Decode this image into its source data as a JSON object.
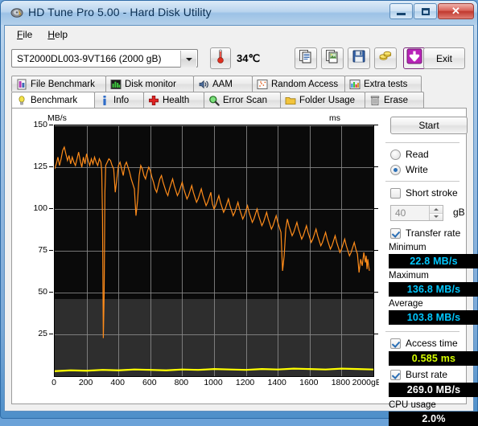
{
  "window": {
    "title": "HD Tune Pro 5.00 - Hard Disk Utility",
    "icon": "hard-disk-icon",
    "minimize_label": "",
    "maximize_label": "",
    "close_label": "✕"
  },
  "menu": {
    "items": [
      {
        "label": "File",
        "accel": "F"
      },
      {
        "label": "Help",
        "accel": "H"
      }
    ]
  },
  "toolbar": {
    "drive": "ST2000DL003-9VT166 (2000 gB)",
    "temperature": "34℃",
    "temperature_icon": "thermometer-icon",
    "buttons": [
      {
        "name": "copy-text-button",
        "icon": "copy-text-icon"
      },
      {
        "name": "copy-image-button",
        "icon": "copy-image-icon"
      },
      {
        "name": "save-button",
        "icon": "floppy-disk-icon"
      },
      {
        "name": "buy-button",
        "icon": "coins-icon"
      },
      {
        "name": "download-button",
        "icon": "download-arrow-icon"
      }
    ],
    "exit_label": "Exit"
  },
  "tabs": {
    "row1": [
      {
        "label": "File Benchmark",
        "icon": "file-benchmark-icon",
        "active": false
      },
      {
        "label": "Disk monitor",
        "icon": "bar-chart-icon",
        "active": false
      },
      {
        "label": "AAM",
        "icon": "speaker-icon",
        "active": false
      },
      {
        "label": "Random Access",
        "icon": "scatter-icon",
        "active": false
      },
      {
        "label": "Extra tests",
        "icon": "extra-chart-icon",
        "active": false
      }
    ],
    "row2": [
      {
        "label": "Benchmark",
        "icon": "lightbulb-icon",
        "active": true
      },
      {
        "label": "Info",
        "icon": "info-icon",
        "active": false
      },
      {
        "label": "Health",
        "icon": "red-cross-icon",
        "active": false
      },
      {
        "label": "Error Scan",
        "icon": "magnifier-icon",
        "active": false
      },
      {
        "label": "Folder Usage",
        "icon": "folder-icon",
        "active": false
      },
      {
        "label": "Erase",
        "icon": "trash-icon",
        "active": false
      }
    ]
  },
  "sidebar": {
    "start_label": "Start",
    "mode": {
      "read_label": "Read",
      "write_label": "Write",
      "selected": "Write"
    },
    "short_stroke": {
      "label": "Short stroke",
      "checked": false,
      "value": "40",
      "unit": "gB"
    },
    "transfer_rate": {
      "label": "Transfer rate",
      "checked": true
    },
    "results": [
      {
        "label": "Minimum",
        "value": "22.8 MB/s",
        "color": "#00c8ff"
      },
      {
        "label": "Maximum",
        "value": "136.8 MB/s",
        "color": "#00c8ff"
      },
      {
        "label": "Average",
        "value": "103.8 MB/s",
        "color": "#00c8ff"
      }
    ],
    "access_time": {
      "label": "Access time",
      "checked": true,
      "value": "0.585 ms",
      "color": "#d7ff00"
    },
    "burst_rate": {
      "label": "Burst rate",
      "checked": true,
      "value": "269.0 MB/s",
      "color": "#ffffff"
    },
    "cpu_usage": {
      "label": "CPU usage",
      "value": "2.0%",
      "color": "#ffffff"
    }
  },
  "chart_data": {
    "type": "line",
    "title": "",
    "ylabel": "MB/s",
    "ylabel_right": "ms",
    "xlabel": "gB",
    "xlim": [
      0,
      2000
    ],
    "ylim": [
      0,
      150
    ],
    "ylim_right": [
      0,
      60
    ],
    "grid": true,
    "legend": "none",
    "xticks": [
      0,
      200,
      400,
      600,
      800,
      1000,
      1200,
      1400,
      1600,
      1800,
      2000
    ],
    "xtick_labels": [
      "0",
      "200",
      "400",
      "600",
      "800",
      "1000",
      "1200",
      "1400",
      "1600",
      "1800",
      "2000gB"
    ],
    "yticks_left": [
      150,
      125,
      100,
      75,
      50,
      25
    ],
    "yticks_right": [
      60,
      50,
      40,
      30,
      20,
      10
    ],
    "series": [
      {
        "name": "Transfer rate",
        "color": "#ff8c1a",
        "axis": "left",
        "units": "MB/s",
        "x": [
          0,
          10,
          20,
          30,
          40,
          50,
          60,
          70,
          80,
          90,
          100,
          110,
          120,
          130,
          140,
          150,
          160,
          170,
          180,
          190,
          200,
          210,
          220,
          230,
          240,
          250,
          260,
          270,
          280,
          290,
          295,
          300,
          305,
          310,
          315,
          320,
          330,
          340,
          350,
          360,
          370,
          380,
          390,
          400,
          410,
          420,
          430,
          440,
          450,
          460,
          470,
          480,
          490,
          500,
          510,
          520,
          530,
          540,
          550,
          560,
          570,
          580,
          590,
          600,
          610,
          620,
          630,
          640,
          650,
          660,
          670,
          680,
          690,
          700,
          710,
          720,
          730,
          740,
          750,
          760,
          770,
          780,
          790,
          800,
          810,
          820,
          830,
          840,
          850,
          860,
          870,
          880,
          890,
          900,
          910,
          920,
          930,
          940,
          950,
          960,
          970,
          980,
          985,
          990,
          1000,
          1010,
          1020,
          1030,
          1040,
          1050,
          1060,
          1070,
          1080,
          1090,
          1100,
          1110,
          1120,
          1130,
          1140,
          1150,
          1160,
          1170,
          1180,
          1190,
          1200,
          1210,
          1220,
          1230,
          1240,
          1250,
          1260,
          1270,
          1280,
          1290,
          1300,
          1310,
          1320,
          1330,
          1340,
          1350,
          1360,
          1370,
          1380,
          1390,
          1400,
          1410,
          1420,
          1430,
          1440,
          1450,
          1455,
          1460,
          1470,
          1480,
          1490,
          1500,
          1510,
          1520,
          1530,
          1540,
          1550,
          1560,
          1570,
          1580,
          1590,
          1600,
          1610,
          1620,
          1630,
          1640,
          1650,
          1660,
          1670,
          1680,
          1690,
          1700,
          1710,
          1720,
          1730,
          1740,
          1750,
          1760,
          1770,
          1780,
          1790,
          1800,
          1810,
          1820,
          1830,
          1840,
          1850,
          1860,
          1870,
          1880,
          1890,
          1900,
          1910,
          1920,
          1930,
          1940,
          1950,
          1955,
          1960,
          1965,
          1970,
          1975,
          1980,
          1985,
          1990,
          1995,
          2000
        ],
        "y": [
          124,
          127,
          131,
          126,
          130,
          135,
          137,
          133,
          129,
          132,
          127,
          131,
          128,
          126,
          130,
          134,
          129,
          125,
          131,
          127,
          133,
          129,
          126,
          130,
          127,
          131,
          128,
          126,
          130,
          128,
          123,
          95,
          22.8,
          48,
          110,
          126,
          128,
          130,
          129,
          126,
          124,
          110,
          118,
          126,
          128,
          124,
          120,
          126,
          128,
          125,
          122,
          118,
          115,
          112,
          96,
          105,
          120,
          126,
          124,
          120,
          118,
          122,
          125,
          123,
          119,
          116,
          112,
          110,
          114,
          118,
          120,
          116,
          113,
          110,
          108,
          112,
          115,
          118,
          114,
          111,
          108,
          110,
          113,
          116,
          112,
          109,
          106,
          108,
          111,
          114,
          110,
          107,
          104,
          106,
          109,
          112,
          108,
          105,
          102,
          104,
          107,
          110,
          106,
          103,
          100,
          102,
          105,
          108,
          104,
          101,
          98,
          100,
          103,
          106,
          102,
          99,
          96,
          98,
          101,
          104,
          100,
          97,
          94,
          96,
          99,
          102,
          98,
          95,
          92,
          94,
          97,
          100,
          96,
          93,
          90,
          92,
          95,
          98,
          94,
          91,
          88,
          90,
          93,
          96,
          92,
          89,
          86,
          63,
          72,
          88,
          91,
          94,
          90,
          87,
          84,
          86,
          89,
          92,
          88,
          85,
          82,
          84,
          87,
          90,
          86,
          83,
          80,
          82,
          85,
          88,
          84,
          81,
          78,
          80,
          83,
          86,
          82,
          79,
          76,
          78,
          81,
          84,
          80,
          77,
          74,
          76,
          79,
          82,
          78,
          75,
          72,
          74,
          77,
          80,
          76,
          73,
          62,
          70,
          66,
          74,
          68,
          72,
          64,
          70,
          66,
          63
        ]
      },
      {
        "name": "Access time",
        "color": "#ffff00",
        "axis": "right",
        "units": "ms",
        "x": [
          0,
          100,
          200,
          300,
          400,
          500,
          600,
          700,
          800,
          900,
          1000,
          1100,
          1200,
          1300,
          1400,
          1500,
          1600,
          1700,
          1800,
          1900,
          2000
        ],
        "y": [
          1.2,
          1.4,
          1.3,
          1.5,
          1.4,
          1.6,
          1.5,
          1.4,
          1.6,
          1.5,
          1.7,
          1.6,
          1.5,
          1.7,
          1.6,
          1.8,
          1.7,
          1.6,
          1.8,
          1.7,
          1.6
        ]
      }
    ]
  }
}
